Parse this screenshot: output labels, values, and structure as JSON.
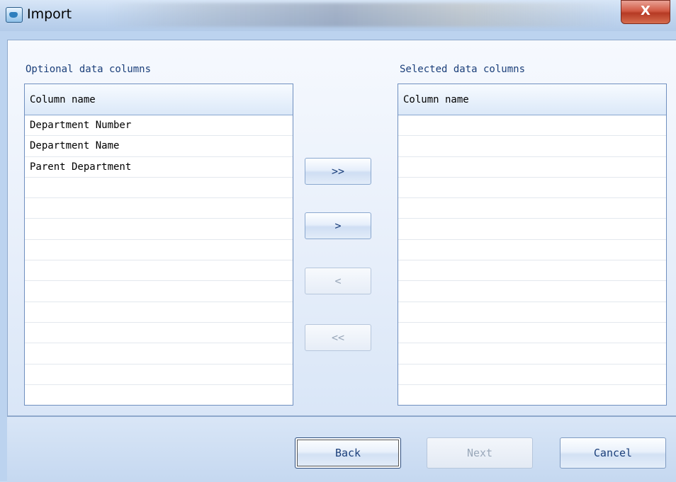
{
  "window": {
    "title": "Import",
    "close_glyph": "X",
    "icon": "app-import-icon"
  },
  "optional": {
    "label": "Optional data columns",
    "header": "Column name",
    "rows": [
      "Department Number",
      "Department Name",
      "Parent Department",
      "",
      "",
      "",
      "",
      "",
      "",
      "",
      "",
      "",
      "",
      ""
    ]
  },
  "selected": {
    "label": "Selected data columns",
    "header": "Column name",
    "rows": [
      "",
      "",
      "",
      "",
      "",
      "",
      "",
      "",
      "",
      "",
      "",
      "",
      "",
      ""
    ]
  },
  "transfer": {
    "add_all": "»",
    "add_all_text": ">>",
    "add": ">",
    "remove": "<",
    "remove_all": "<<"
  },
  "footer": {
    "back": "Back",
    "next": "Next",
    "cancel": "Cancel"
  },
  "colors": {
    "accent": "#1b3f7a",
    "disabled_text": "#9aa8ba",
    "close_red": "#c9482f"
  }
}
